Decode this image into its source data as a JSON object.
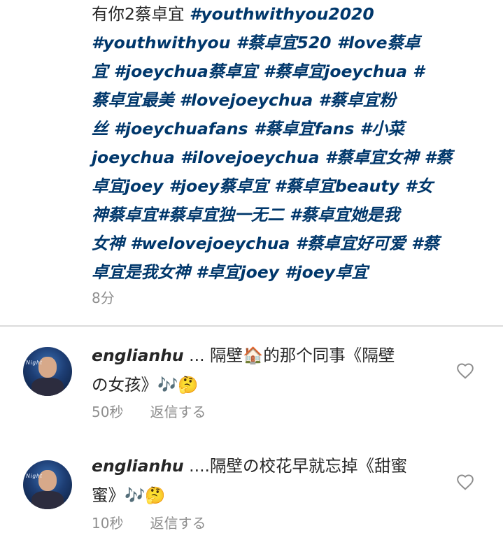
{
  "caption": {
    "lines": [
      [
        {
          "t": "有你2蔡卓宜 ",
          "tag": false
        },
        {
          "t": "#youthwithyou2020",
          "tag": true
        }
      ],
      [
        {
          "t": "#youthwithyou #蔡卓宜520 #love蔡卓",
          "tag": true
        }
      ],
      [
        {
          "t": "宜 #joeychua蔡卓宜 #蔡卓宜joeychua #",
          "tag": true
        }
      ],
      [
        {
          "t": "蔡卓宜最美 #lovejoeychua #蔡卓宜粉",
          "tag": true
        }
      ],
      [
        {
          "t": "丝 #joeychuafans #蔡卓宜fans #小菜",
          "tag": true
        }
      ],
      [
        {
          "t": "joeychua #ilovejoeychua #蔡卓宜女神 #蔡",
          "tag": true
        }
      ],
      [
        {
          "t": "卓宜joey #joey蔡卓宜 #蔡卓宜beauty #女",
          "tag": true
        }
      ],
      [
        {
          "t": "神蔡卓宜#蔡卓宜独一无二 #蔡卓宜她是我",
          "tag": true
        }
      ],
      [
        {
          "t": "女神 #welovejoeychua #蔡卓宜好可爱 #蔡",
          "tag": true
        }
      ],
      [
        {
          "t": "卓宜是我女神 #卓宜joey #joey卓宜",
          "tag": true
        }
      ]
    ],
    "time": "8分"
  },
  "comments": [
    {
      "username": "englianhu",
      "line1": " ... 隔壁🏠的那个同事《隔壁",
      "line2": "の女孩》🎶🤔",
      "time": "50秒",
      "reply": "返信する"
    },
    {
      "username": "englianhu",
      "line1": " ....隔壁の校花早就忘掉《甜蜜",
      "line2": "蜜》🎶🤔",
      "time": "10秒",
      "reply": "返信する"
    }
  ],
  "colors": {
    "hashtag": "#00376b",
    "text": "#262626",
    "secondary": "#8e8e8e",
    "divider": "#dbdbdb"
  },
  "icons": {
    "like": "heart-outline-icon"
  }
}
